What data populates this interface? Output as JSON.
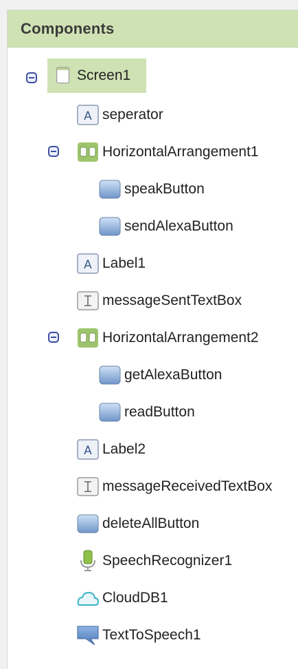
{
  "panel": {
    "title": "Components"
  },
  "tree": {
    "screen": {
      "label": "Screen1",
      "icon": "screen-icon"
    },
    "items": [
      {
        "label": "seperator",
        "icon": "label-icon"
      },
      {
        "label": "HorizontalArrangement1",
        "icon": "horizontal-arrangement-icon"
      },
      {
        "label": "speakButton",
        "icon": "button-icon"
      },
      {
        "label": "sendAlexaButton",
        "icon": "button-icon"
      },
      {
        "label": "Label1",
        "icon": "label-icon"
      },
      {
        "label": "messageSentTextBox",
        "icon": "textbox-icon"
      },
      {
        "label": "HorizontalArrangement2",
        "icon": "horizontal-arrangement-icon"
      },
      {
        "label": "getAlexaButton",
        "icon": "button-icon"
      },
      {
        "label": "readButton",
        "icon": "button-icon"
      },
      {
        "label": "Label2",
        "icon": "label-icon"
      },
      {
        "label": "messageReceivedTextBox",
        "icon": "textbox-icon"
      },
      {
        "label": "deleteAllButton",
        "icon": "button-icon"
      },
      {
        "label": "SpeechRecognizer1",
        "icon": "speech-recognizer-icon"
      },
      {
        "label": "CloudDB1",
        "icon": "clouddb-icon"
      },
      {
        "label": "TextToSpeech1",
        "icon": "text-to-speech-icon"
      }
    ]
  },
  "colors": {
    "header_bg": "#cfe2b4",
    "selected_bg": "#cfe2b4",
    "toggle": "#3a4fa0"
  }
}
